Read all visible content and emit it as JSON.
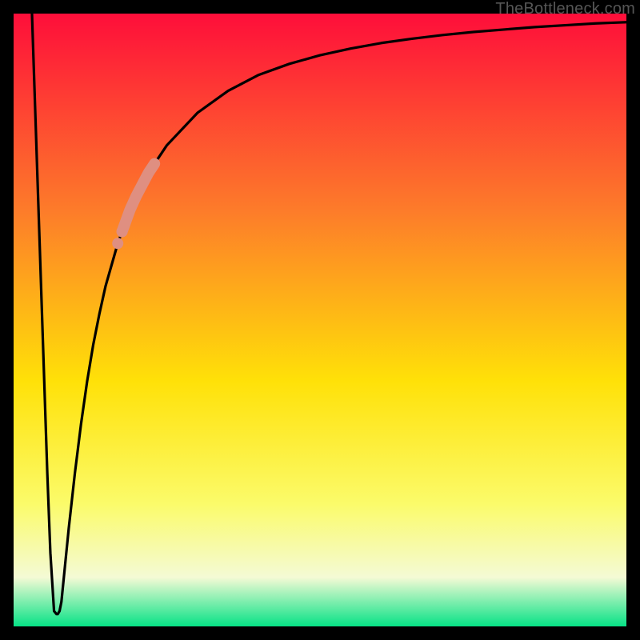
{
  "watermark": "TheBottleneck.com",
  "colors": {
    "frame": "#000000",
    "curve": "#000000",
    "highlight": "#df8f81",
    "grad_top": "#fe0e3a",
    "grad_mid_upper": "#fd7b2a",
    "grad_mid": "#ffe108",
    "grad_mid_lower": "#fbfb6a",
    "grad_low": "#f4fad5",
    "grad_bottom": "#06e286"
  },
  "chart_data": {
    "type": "line",
    "title": "",
    "xlabel": "",
    "ylabel": "",
    "xlim": [
      0,
      100
    ],
    "ylim": [
      0,
      100
    ],
    "series": [
      {
        "name": "bottleneck-curve",
        "x": [
          3.0,
          3.5,
          4.0,
          4.5,
          5.0,
          5.5,
          6.0,
          6.6,
          7.0,
          7.2,
          7.5,
          7.8,
          8.0,
          8.5,
          9.0,
          10.0,
          11.0,
          12.0,
          13.0,
          14.0,
          15.0,
          17.0,
          19.0,
          20.0,
          22.0,
          25.0,
          30.0,
          35.0,
          40.0,
          45.0,
          50.0,
          55.0,
          60.0,
          65.0,
          70.0,
          75.0,
          80.0,
          85.0,
          90.0,
          95.0,
          100.0
        ],
        "y": [
          100.0,
          85.0,
          70.0,
          55.0,
          40.0,
          25.0,
          12.0,
          2.5,
          2.0,
          2.0,
          2.5,
          4.0,
          6.0,
          11.0,
          16.0,
          25.0,
          33.0,
          40.0,
          46.0,
          51.0,
          55.5,
          62.5,
          68.0,
          70.2,
          74.0,
          78.5,
          83.8,
          87.4,
          90.0,
          91.8,
          93.2,
          94.3,
          95.2,
          95.9,
          96.5,
          97.0,
          97.4,
          97.8,
          98.1,
          98.4,
          98.6
        ]
      }
    ],
    "highlight_segment": {
      "series": "bottleneck-curve",
      "x_start": 17.7,
      "x_end": 23.0
    },
    "highlight_dots": {
      "series": "bottleneck-curve",
      "x": [
        17.0,
        17.7
      ]
    }
  }
}
